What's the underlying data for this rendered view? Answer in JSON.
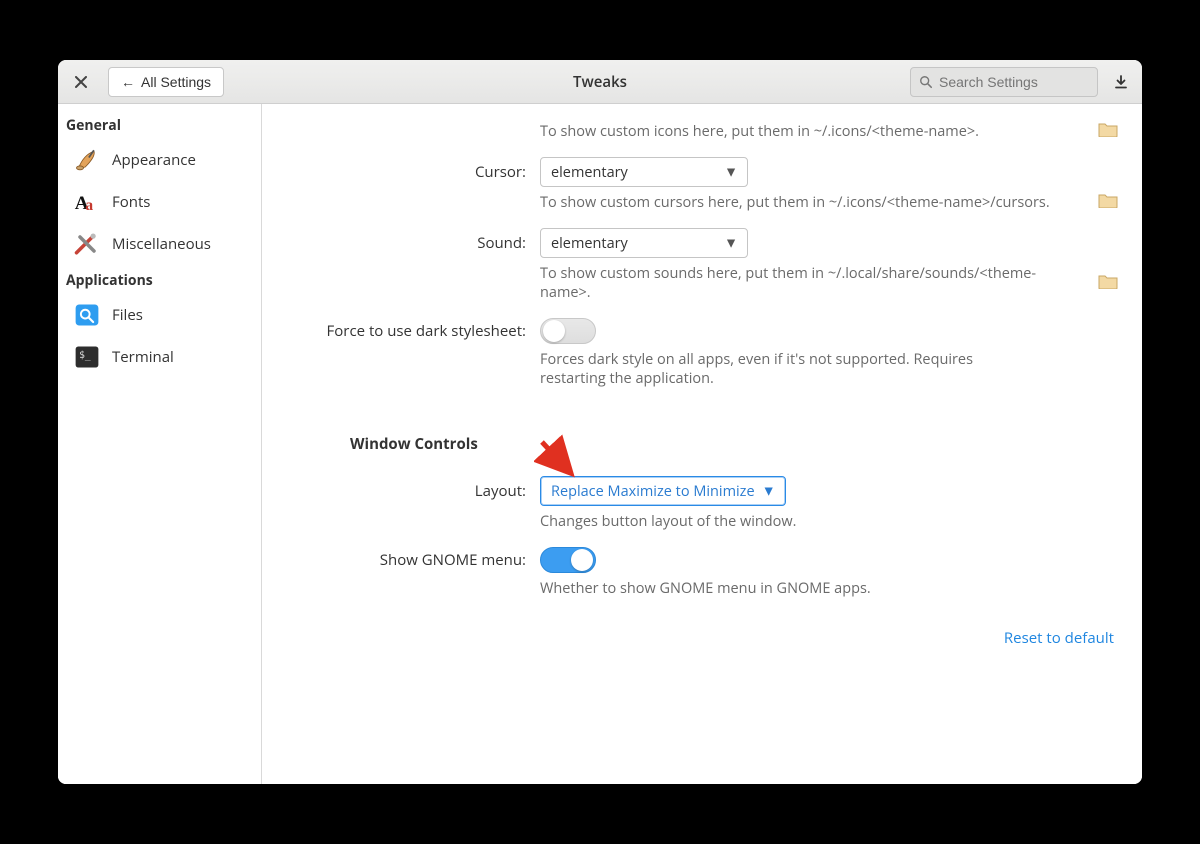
{
  "header": {
    "back_label": "All Settings",
    "title": "Tweaks",
    "search_placeholder": "Search Settings"
  },
  "sidebar": {
    "groups": [
      {
        "label": "General",
        "items": [
          {
            "label": "Appearance"
          },
          {
            "label": "Fonts"
          },
          {
            "label": "Miscellaneous"
          }
        ]
      },
      {
        "label": "Applications",
        "items": [
          {
            "label": "Files"
          },
          {
            "label": "Terminal"
          }
        ]
      }
    ]
  },
  "content": {
    "icons_hint": "To show custom icons here, put them in ~/.icons/<theme-name>.",
    "cursor": {
      "label": "Cursor:",
      "value": "elementary",
      "hint": "To show custom cursors here, put them in ~/.icons/<theme-name>/cursors."
    },
    "sound": {
      "label": "Sound:",
      "value": "elementary",
      "hint": "To show custom sounds here, put them in ~/.local/share/sounds/<theme-name>."
    },
    "dark": {
      "label": "Force to use dark stylesheet:",
      "hint": "Forces dark style on all apps, even if it's not supported. Requires restarting the application."
    },
    "window_controls_heading": "Window Controls",
    "layout": {
      "label": "Layout:",
      "value": "Replace Maximize to Minimize",
      "hint": "Changes button layout of the window."
    },
    "gnome": {
      "label": "Show GNOME menu:",
      "hint": "Whether to show GNOME menu in GNOME apps."
    },
    "reset_label": "Reset to default"
  }
}
